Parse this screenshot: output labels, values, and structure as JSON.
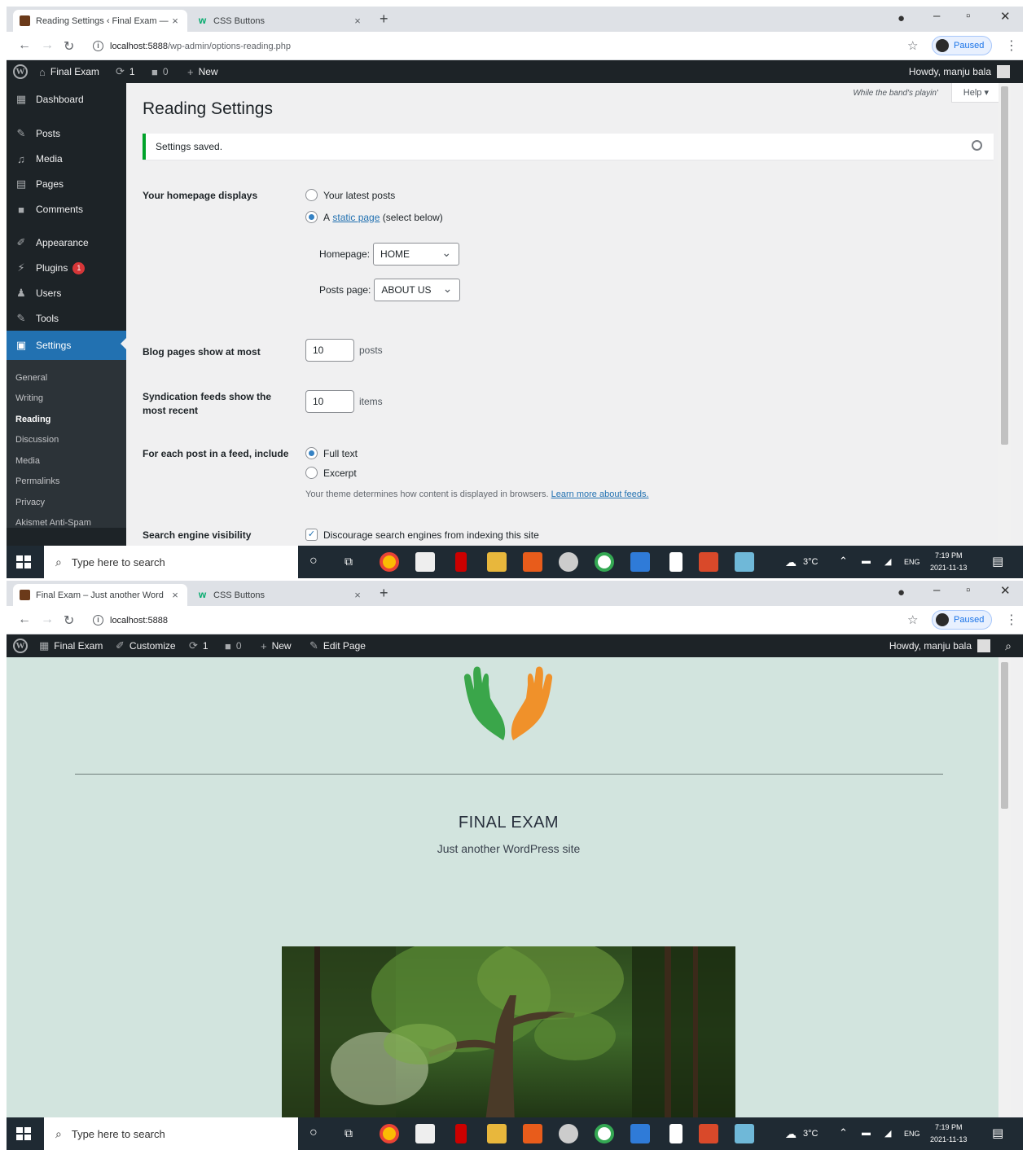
{
  "shot1": {
    "tabs": [
      {
        "title": "Reading Settings ‹ Final Exam —",
        "close": "×"
      },
      {
        "title": "CSS Buttons",
        "close": "×"
      }
    ],
    "new_tab": "+",
    "window_controls": {
      "minimize": "–",
      "maximize": "▫",
      "close": "✕"
    },
    "url": {
      "host": "localhost:5888",
      "path": "/wp-admin/options-reading.php"
    },
    "profile_label": "Paused",
    "adminbar": {
      "site_name": "Final Exam",
      "updates_count": "1",
      "comments_count": "0",
      "new_label": "New",
      "howdy": "Howdy, manju bala"
    },
    "sidebar": {
      "items": [
        {
          "label": "Dashboard",
          "icon": "dashboard-icon"
        },
        {
          "label": "Posts",
          "icon": "pin-icon"
        },
        {
          "label": "Media",
          "icon": "media-icon"
        },
        {
          "label": "Pages",
          "icon": "pages-icon"
        },
        {
          "label": "Comments",
          "icon": "comment-icon"
        },
        {
          "label": "Appearance",
          "icon": "brush-icon"
        },
        {
          "label": "Plugins",
          "icon": "plug-icon",
          "badge": "1"
        },
        {
          "label": "Users",
          "icon": "user-icon"
        },
        {
          "label": "Tools",
          "icon": "wrench-icon"
        },
        {
          "label": "Settings",
          "icon": "settings-icon"
        }
      ],
      "submenu": [
        "General",
        "Writing",
        "Reading",
        "Discussion",
        "Media",
        "Permalinks",
        "Privacy",
        "Akismet Anti-Spam"
      ]
    },
    "screen_meta": {
      "lyric": "While the band's playin'",
      "help": "Help ▾"
    },
    "page_title": "Reading Settings",
    "notice": "Settings saved.",
    "homepage": {
      "label": "Your homepage displays",
      "option_latest": "Your latest posts",
      "option_static_prefix": "A",
      "option_static_link": "static page",
      "option_static_suffix": "(select below)",
      "homepage_label": "Homepage:",
      "homepage_value": "HOME",
      "posts_page_label": "Posts page:",
      "posts_page_value": "ABOUT US"
    },
    "blog_pages": {
      "label": "Blog pages show at most",
      "value": "10",
      "unit": "posts"
    },
    "syndication": {
      "label": "Syndication feeds show the most recent",
      "value": "10",
      "unit": "items"
    },
    "feed_include": {
      "label": "For each post in a feed, include",
      "option_full": "Full text",
      "option_excerpt": "Excerpt",
      "desc": "Your theme determines how content is displayed in browsers.",
      "desc_link": "Learn more about feeds."
    },
    "search_visibility": {
      "label": "Search engine visibility",
      "checkbox": "Discourage search engines from indexing this site"
    },
    "taskbar": {
      "search_placeholder": "Type here to search",
      "weather": "3°C",
      "lang": "ENG",
      "time": "7:19 PM",
      "date": "2021-11-13"
    }
  },
  "shot2": {
    "tabs": [
      {
        "title": "Final Exam – Just another Word",
        "close": "×"
      },
      {
        "title": "CSS Buttons",
        "close": "×"
      }
    ],
    "new_tab": "+",
    "window_controls": {
      "minimize": "–",
      "maximize": "▫",
      "close": "✕"
    },
    "url": {
      "host": "localhost:5888"
    },
    "profile_label": "Paused",
    "adminbar": {
      "site_name": "Final Exam",
      "customize": "Customize",
      "updates_count": "1",
      "comments_count": "0",
      "new_label": "New",
      "edit_page": "Edit Page",
      "howdy": "Howdy, manju bala"
    },
    "site": {
      "title": "FINAL EXAM",
      "tagline": "Just another WordPress site"
    },
    "taskbar": {
      "search_placeholder": "Type here to search",
      "weather": "3°C",
      "lang": "ENG",
      "time": "7:19 PM",
      "date": "2021-11-13"
    }
  },
  "colors": {
    "wp_admin_dark": "#1d2327",
    "wp_blue": "#2271b1",
    "notice_success": "#00a32a",
    "site_background": "#d2e4de",
    "logo_green": "#3aa64a",
    "logo_orange": "#f0912a"
  }
}
